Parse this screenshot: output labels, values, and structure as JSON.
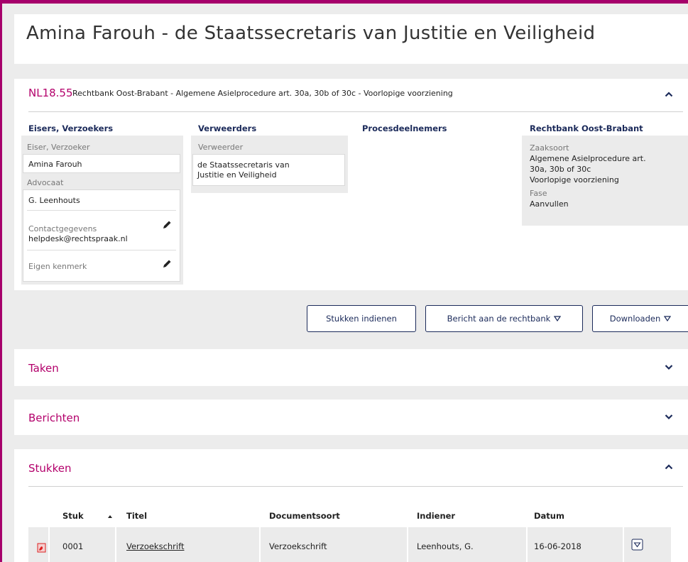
{
  "page": {
    "title": "Amina Farouh - de Staatssecretaris van Justitie en Veiligheid"
  },
  "case": {
    "number": "NL18.55",
    "description": "Rechtbank Oost-Brabant - Algemene Asielprocedure art. 30a, 30b of 30c - Voorlopige voorziening",
    "claimants": {
      "heading": "Eisers, Verzoekers",
      "role_label": "Eiser, Verzoeker",
      "name": "Amina Farouh",
      "lawyer_label": "Advocaat",
      "lawyer_name": "G. Leenhouts",
      "contact_label": "Contactgegevens",
      "contact_value": "helpdesk@rechtspraak.nl",
      "reference_label": "Eigen kenmerk"
    },
    "defendants": {
      "heading": "Verweerders",
      "role_label": "Verweerder",
      "name_line1": "de Staatssecretaris van",
      "name_line2": "Justitie en Veiligheid"
    },
    "participants": {
      "heading": "Procesdeelnemers"
    },
    "court": {
      "heading": "Rechtbank Oost-Brabant",
      "case_type_label": "Zaaksoort",
      "case_type_line1": "Algemene Asielprocedure art.",
      "case_type_line2": "30a, 30b of 30c",
      "case_type_line3": "Voorlopige voorziening",
      "phase_label": "Fase",
      "phase_value": "Aanvullen"
    }
  },
  "actions": {
    "submit_label": "Stukken indienen",
    "message_label": "Bericht aan de rechtbank",
    "download_label": "Downloaden"
  },
  "sections": {
    "tasks": "Taken",
    "messages": "Berichten",
    "documents": "Stukken"
  },
  "documents_table": {
    "columns": [
      "Stuk",
      "Titel",
      "Documentsoort",
      "Indiener",
      "Datum"
    ],
    "rows": [
      {
        "stuk": "0001",
        "titel": "Verzoekschrift",
        "documentsoort": "Verzoekschrift",
        "indiener": "Leenhouts, G.",
        "datum": "16-06-2018"
      }
    ]
  },
  "icons": [
    "chevron-up-icon",
    "chevron-down-icon",
    "pencil-icon",
    "triangle-down-icon",
    "sort-ascending-icon",
    "pdf-icon",
    "row-menu-icon"
  ],
  "colors": {
    "accent": "#b3006b",
    "frame": "#a6006b",
    "navy": "#1b2a5a",
    "panel_gray": "#ebebeb",
    "background": "#ececec"
  }
}
